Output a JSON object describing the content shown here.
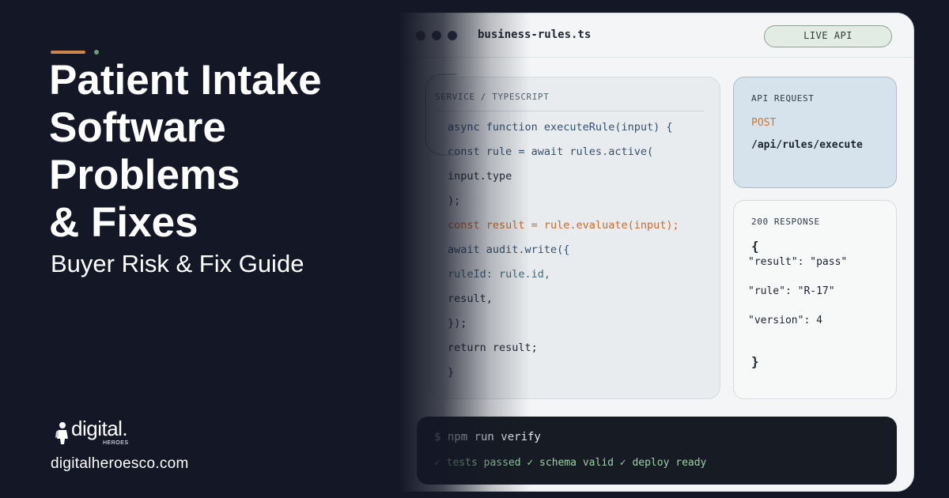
{
  "left": {
    "headline_lines": [
      "Patient Intake",
      "Software",
      "Problems",
      "& Fixes"
    ],
    "subtitle": "Buyer Risk & Fix Guide",
    "logo": {
      "name": "digital.",
      "tagline": "HEROES"
    },
    "website": "digitalheroesco.com"
  },
  "editor": {
    "file_name": "business-rules.ts",
    "badge": "LIVE API",
    "code_label": "SERVICE / TYPESCRIPT",
    "code_lines": [
      "async function executeRule(input) {",
      "const rule = await rules.active(",
      "input.type",
      ");",
      "const result = rule.evaluate(input);",
      "await audit.write({",
      "ruleId: rule.id,",
      "result,",
      "});",
      "return result;",
      "}"
    ],
    "request": {
      "label": "API REQUEST",
      "method": "POST",
      "path": "/api/rules/execute"
    },
    "response": {
      "label": "200 RESPONSE",
      "open_brace": "{",
      "lines": [
        "\"result\": \"pass\"",
        "\"rule\": \"R-17\"",
        "\"version\": 4"
      ],
      "close_brace": "}"
    },
    "terminal": {
      "command": "$ npm run verify",
      "output": "✓ tests passed ✓ schema valid ✓ deploy ready"
    }
  },
  "colors": {
    "background": "#141726",
    "accent_orange": "#d0854b",
    "accent_green": "#6aa072",
    "method_orange": "#d2772c"
  }
}
